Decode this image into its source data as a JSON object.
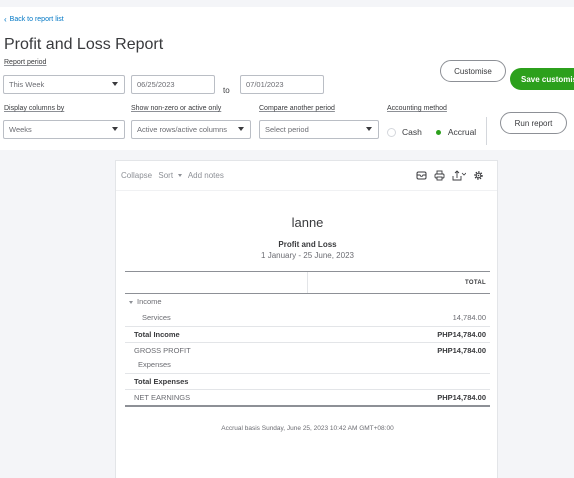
{
  "header": {
    "back_link": "Back to report list",
    "title": "Profit and Loss Report",
    "report_period_label": "Report period",
    "report_period_value": "This Week",
    "date_from": "06/25/2023",
    "to_label": "to",
    "date_to": "07/01/2023",
    "customise_button": "Customise",
    "save_button": "Save customis",
    "display_columns_label": "Display columns by",
    "display_columns_value": "Weeks",
    "show_nonzero_label": "Show non-zero or active only",
    "show_nonzero_value": "Active rows/active columns",
    "compare_label": "Compare another period",
    "compare_placeholder": "Select period",
    "accounting_method_label": "Accounting method",
    "cash_label": "Cash",
    "accrual_label": "Accrual",
    "accounting_method_selected": "Accrual",
    "run_report_button": "Run report"
  },
  "report": {
    "toolbar": {
      "collapse": "Collapse",
      "sort": "Sort",
      "add_notes": "Add notes"
    },
    "company_name": "lanne",
    "report_title": "Profit and Loss",
    "date_range": "1 January - 25 June, 2023",
    "column_header": "TOTAL",
    "rows": [
      {
        "label": "Income",
        "value": ""
      },
      {
        "label": "Services",
        "value": "14,784.00"
      },
      {
        "label": "Total Income",
        "value": "PHP14,784.00"
      },
      {
        "label": "GROSS PROFIT",
        "value": "PHP14,784.00"
      },
      {
        "label": "Expenses",
        "value": ""
      },
      {
        "label": "Total Expenses",
        "value": ""
      },
      {
        "label": "NET EARNINGS",
        "value": "PHP14,784.00"
      }
    ],
    "footer": "Accrual basis  Sunday, June 25, 2023  10:42 AM GMT+08:00"
  },
  "colors": {
    "accent_green": "#2ca01c",
    "link_blue": "#0077c5",
    "text_dark": "#393a3d"
  }
}
